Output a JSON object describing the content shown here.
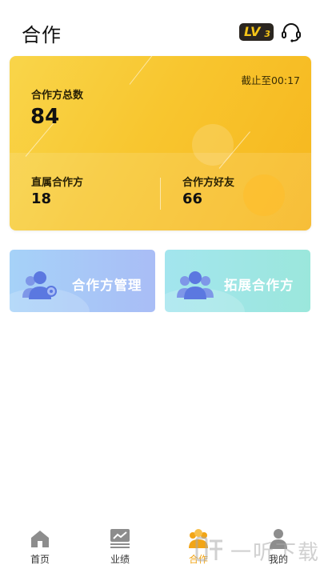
{
  "header": {
    "title": "合作",
    "level_badge": {
      "prefix": "LV",
      "level": "3"
    },
    "support_icon": "headset-icon"
  },
  "summary": {
    "as_of": "截止至00:17",
    "total_label": "合作方总数",
    "total_value": "84",
    "direct_label": "直属合作方",
    "direct_value": "18",
    "friends_label": "合作方好友",
    "friends_value": "66"
  },
  "actions": [
    {
      "label": "合作方管理",
      "icon": "team-settings-icon"
    },
    {
      "label": "拓展合作方",
      "icon": "team-group-icon"
    }
  ],
  "tabbar": {
    "items": [
      {
        "label": "首页",
        "icon": "home-icon"
      },
      {
        "label": "业绩",
        "icon": "chart-icon"
      },
      {
        "label": "合作",
        "icon": "cooperation-icon",
        "active": true
      },
      {
        "label": "我的",
        "icon": "user-icon"
      }
    ]
  },
  "watermark": {
    "text": "一听下载"
  },
  "colors": {
    "card_gradient_start": "#f9d54a",
    "card_gradient_end": "#f6b61d",
    "active_tab": "#f2a516",
    "tile_manage": "#a9c6f7",
    "tile_expand": "#9fe6e4",
    "people_icon": "#5b78e0"
  }
}
